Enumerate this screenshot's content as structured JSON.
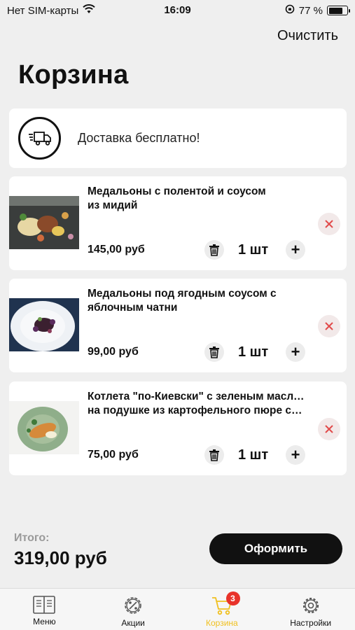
{
  "status_bar": {
    "carrier": "Нет SIM-карты",
    "time": "16:09",
    "battery": "77 %",
    "battery_level": 0.77
  },
  "header": {
    "clear_label": "Очистить",
    "title": "Корзина"
  },
  "delivery": {
    "icon": "delivery-truck-icon",
    "text": "Доставка бесплатно!"
  },
  "items": [
    {
      "title_line1": "Медальоны с полентой и соусом",
      "title_line2": "из мидий",
      "price": "145,00 руб",
      "qty": "1 шт"
    },
    {
      "title_line1": "Медальоны под ягодным соусом с",
      "title_line2": "яблочным чатни",
      "price": "99,00 руб",
      "qty": "1 шт"
    },
    {
      "title_line1": "Котлета \"по-Киевски\" с зеленым маслом",
      "title_line2": "на подушке из картофельного пюре с Д...",
      "price": "75,00 руб",
      "qty": "1 шт"
    }
  ],
  "summary": {
    "total_label": "Итого:",
    "total_value": "319,00 руб",
    "checkout_label": "Оформить"
  },
  "tabs": [
    {
      "label": "Меню",
      "icon": "menu-book-icon"
    },
    {
      "label": "Акции",
      "icon": "percent-gear-icon"
    },
    {
      "label": "Корзина",
      "icon": "cart-icon",
      "badge": "3",
      "active": true
    },
    {
      "label": "Настройки",
      "icon": "settings-gear-icon"
    }
  ],
  "colors": {
    "accent": "#f0c020",
    "badge": "#e8332a",
    "remove": "#e14b4b",
    "button": "#111111"
  }
}
